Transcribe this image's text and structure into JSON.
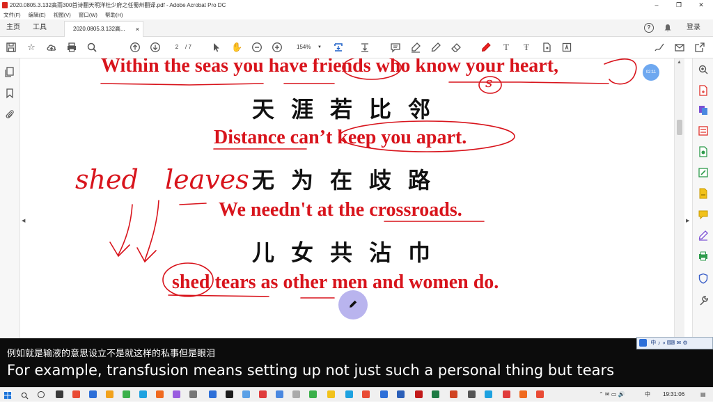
{
  "window": {
    "title": "2020.0805.3.132高雨300首诗翻天明洋杜少府之任蜀州翻译.pdf - Adobe Acrobat Pro DC",
    "controls": [
      "–",
      "❐",
      "✕"
    ]
  },
  "menu": [
    "文件(F)",
    "编辑(E)",
    "视图(V)",
    "窗口(W)",
    "帮助(H)"
  ],
  "tabs": {
    "home": "主页",
    "tools": "工具",
    "document": "2020.0805.3.132高...",
    "close": "×",
    "help": "?",
    "login": "登录"
  },
  "toolbar": {
    "page_current": "2",
    "page_total": "/ 7",
    "zoom": "154%"
  },
  "document": {
    "lines": [
      {
        "en": "Within the seas you have friends who know your heart,"
      },
      {
        "zh": "天涯若比邻"
      },
      {
        "en": "Distance can’t keep you apart."
      },
      {
        "zh": "无为在歧路"
      },
      {
        "en": "We needn't at the crossroads."
      },
      {
        "zh": "儿女共沾巾"
      },
      {
        "en": "shed tears as other men and women do."
      }
    ],
    "handwriting": {
      "word1": "shed",
      "word2": "leaves",
      "circle_mark": "s"
    },
    "timer_badge": "02:11"
  },
  "subtitles": {
    "zh": "例如就是输液的意思设立不是就这样的私事但是眼泪",
    "en": "For example, transfusion means setting up not just such a personal thing but tears"
  },
  "ime_bar": "中 ♪ ◑ ⌨ ✉ ⚙",
  "taskbar": {
    "clock": "19:31:06",
    "tray_lang": "中"
  },
  "colors": {
    "english_text": "#d8141c",
    "annotation": "#d8141c",
    "pen_cursor": "#b9b4ee",
    "timer_badge": "#6ea8f0"
  }
}
